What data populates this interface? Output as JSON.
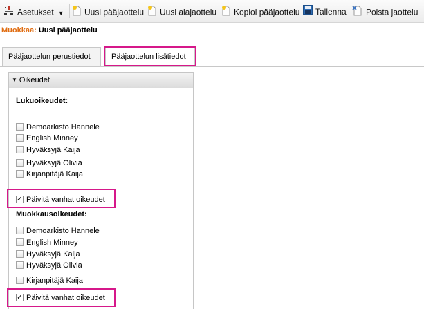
{
  "toolbar": {
    "settings_label": "Asetukset",
    "new_main_label": "Uusi pääjaottelu",
    "new_sub_label": "Uusi alajaottelu",
    "copy_main_label": "Kopioi pääjaottelu",
    "save_label": "Tallenna",
    "delete_label": "Poista jaottelu"
  },
  "edit": {
    "label": "Muokkaa:",
    "value": "Uusi pääjaottelu"
  },
  "tabs": [
    {
      "label": "Pääjaottelun perustiedot",
      "active": false
    },
    {
      "label": "Pääjaottelun lisätiedot",
      "active": true
    }
  ],
  "panel": {
    "title": "Oikeudet",
    "read": {
      "title": "Lukuoikeudet:",
      "users": [
        "Demoarkisto Hannele",
        "English Minney",
        "Hyväksyjä Kaija",
        "Hyväksyjä Olivia",
        "Kirjanpitäjä Kaija"
      ],
      "update_label": "Päivitä vanhat oikeudet",
      "update_checked": true
    },
    "edit": {
      "title": "Muokkausoikeudet:",
      "users": [
        "Demoarkisto Hannele",
        "English Minney",
        "Hyväksyjä Kaija",
        "Hyväksyjä Olivia",
        "Kirjanpitäjä Kaija"
      ],
      "update_label": "Päivitä vanhat oikeudet",
      "update_checked": true
    }
  },
  "colors": {
    "accent": "#e06c10",
    "highlight": "#d6188a"
  }
}
